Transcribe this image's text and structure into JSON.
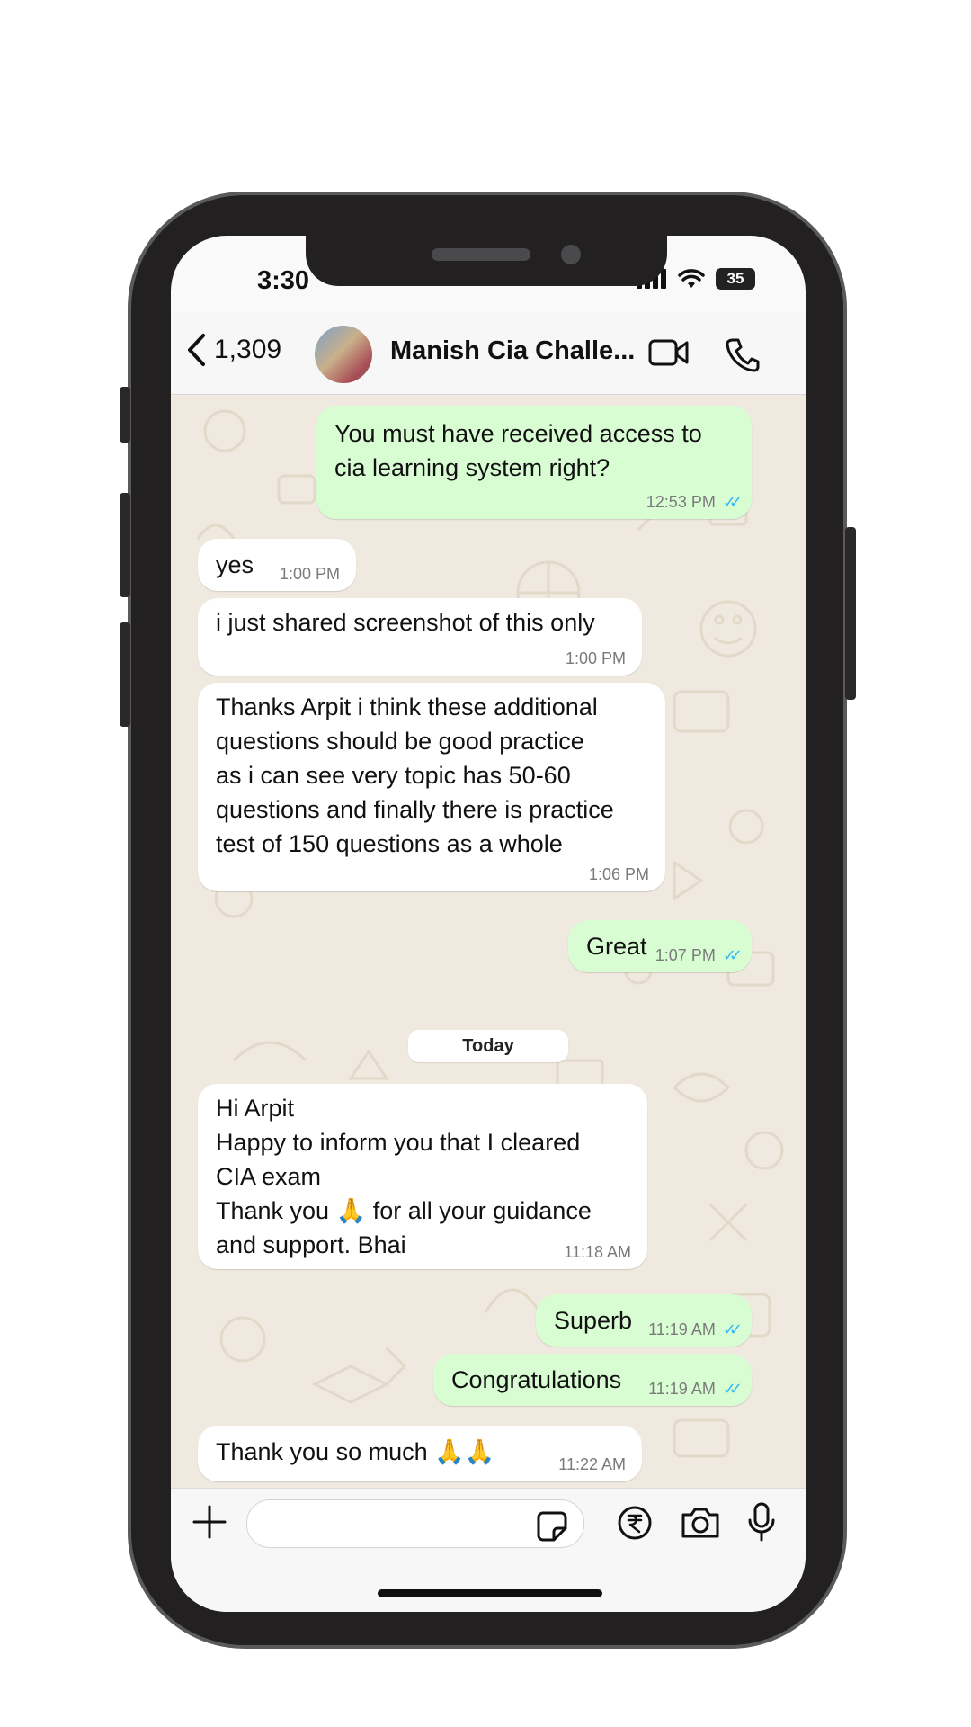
{
  "status_bar": {
    "time": "3:30",
    "battery": "35"
  },
  "header": {
    "back_count": "1,309",
    "contact_name": "Manish Cia Challe...",
    "icons": [
      "chevron-left-icon",
      "video-call-icon",
      "phone-icon"
    ]
  },
  "messages": [
    {
      "direction": "out",
      "text": "You must have received access to\ncia learning system right?",
      "time": "12:53 PM",
      "read": true
    },
    {
      "direction": "in",
      "text": "yes",
      "time": "1:00 PM"
    },
    {
      "direction": "in",
      "text": "i just shared screenshot of this only",
      "time": "1:00 PM"
    },
    {
      "direction": "in",
      "text": "Thanks Arpit i think these additional\nquestions should be good practice\nas i can see very topic has 50-60\nquestions and finally there is practice\ntest of 150 questions as a whole",
      "time": "1:06 PM"
    },
    {
      "direction": "out",
      "text": "Great",
      "time": "1:07 PM",
      "read": true
    },
    {
      "direction": "in",
      "text": "Hi Arpit\nHappy to inform you that I cleared\nCIA exam\nThank you 🙏 for all your guidance\nand support. Bhai",
      "time": "11:18 AM"
    },
    {
      "direction": "out",
      "text": "Superb",
      "time": "11:19 AM",
      "read": true
    },
    {
      "direction": "out",
      "text": "Congratulations",
      "time": "11:19 AM",
      "read": true
    },
    {
      "direction": "in",
      "text": "Thank you so much  🙏🙏",
      "time": "11:22 AM"
    }
  ],
  "date_separator": "Today",
  "input_bar": {
    "placeholder": "",
    "icons": [
      "plus-icon",
      "sticker-icon",
      "rupee-payment-icon",
      "camera-icon",
      "microphone-icon"
    ]
  }
}
